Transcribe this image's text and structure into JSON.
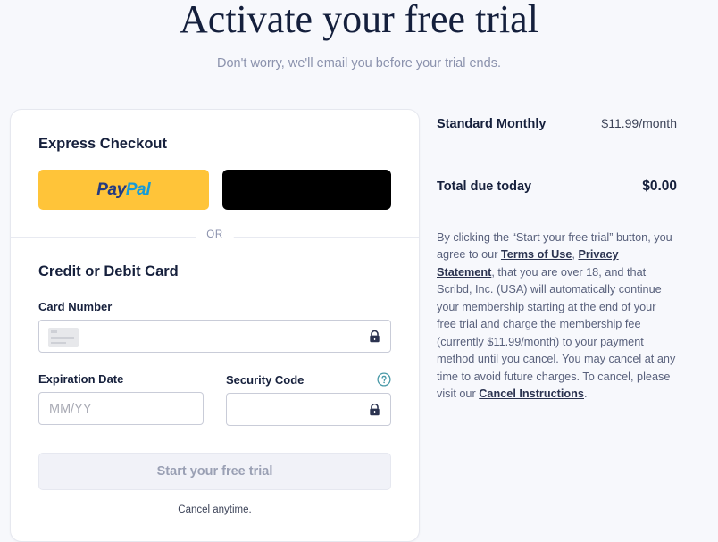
{
  "header": {
    "title": "Activate your free trial",
    "subtitle": "Don't worry, we'll email you before your trial ends."
  },
  "checkout": {
    "express_title": "Express Checkout",
    "paypal_pay": "Pay",
    "paypal_pal": "Pal",
    "applepay_label": "",
    "divider_label": "OR",
    "card_section_title": "Credit or Debit Card",
    "card_number_label": "Card Number",
    "card_number_value": "",
    "card_number_placeholder": "",
    "expiration_label": "Expiration Date",
    "expiration_value": "",
    "expiration_placeholder": "MM/YY",
    "security_label": "Security Code",
    "security_value": "",
    "security_placeholder": "",
    "submit_label": "Start your free trial",
    "cancel_note": "Cancel anytime."
  },
  "summary": {
    "plan_name": "Standard Monthly",
    "plan_price": "$11.99/month",
    "total_label": "Total due today",
    "total_value": "$0.00",
    "legal": {
      "part1": "By clicking the “Start your free trial” button, you agree to our ",
      "link_terms": "Terms of Use",
      "part2": ", ",
      "link_privacy": "Privacy Statement",
      "part3": ", that you are over 18, and that Scribd, Inc. (USA) will automatically continue your membership starting at the end of your free trial and charge the membership fee (currently $11.99/month) to your payment method until you cancel. You may cancel at any time to avoid future charges. To cancel, please visit our ",
      "link_cancel": "Cancel Instructions",
      "part4": "."
    }
  },
  "colors": {
    "page_background": "#f7f8fc",
    "paypal_yellow": "#ffc439",
    "paypal_dark_blue": "#253b80",
    "paypal_light_blue": "#179bd7",
    "applepay_black": "#000000",
    "text_dark": "#16203c",
    "text_muted": "#8b92ad",
    "help_icon_teal": "#4a9aa8",
    "submit_disabled_bg": "#f1f2f8"
  }
}
